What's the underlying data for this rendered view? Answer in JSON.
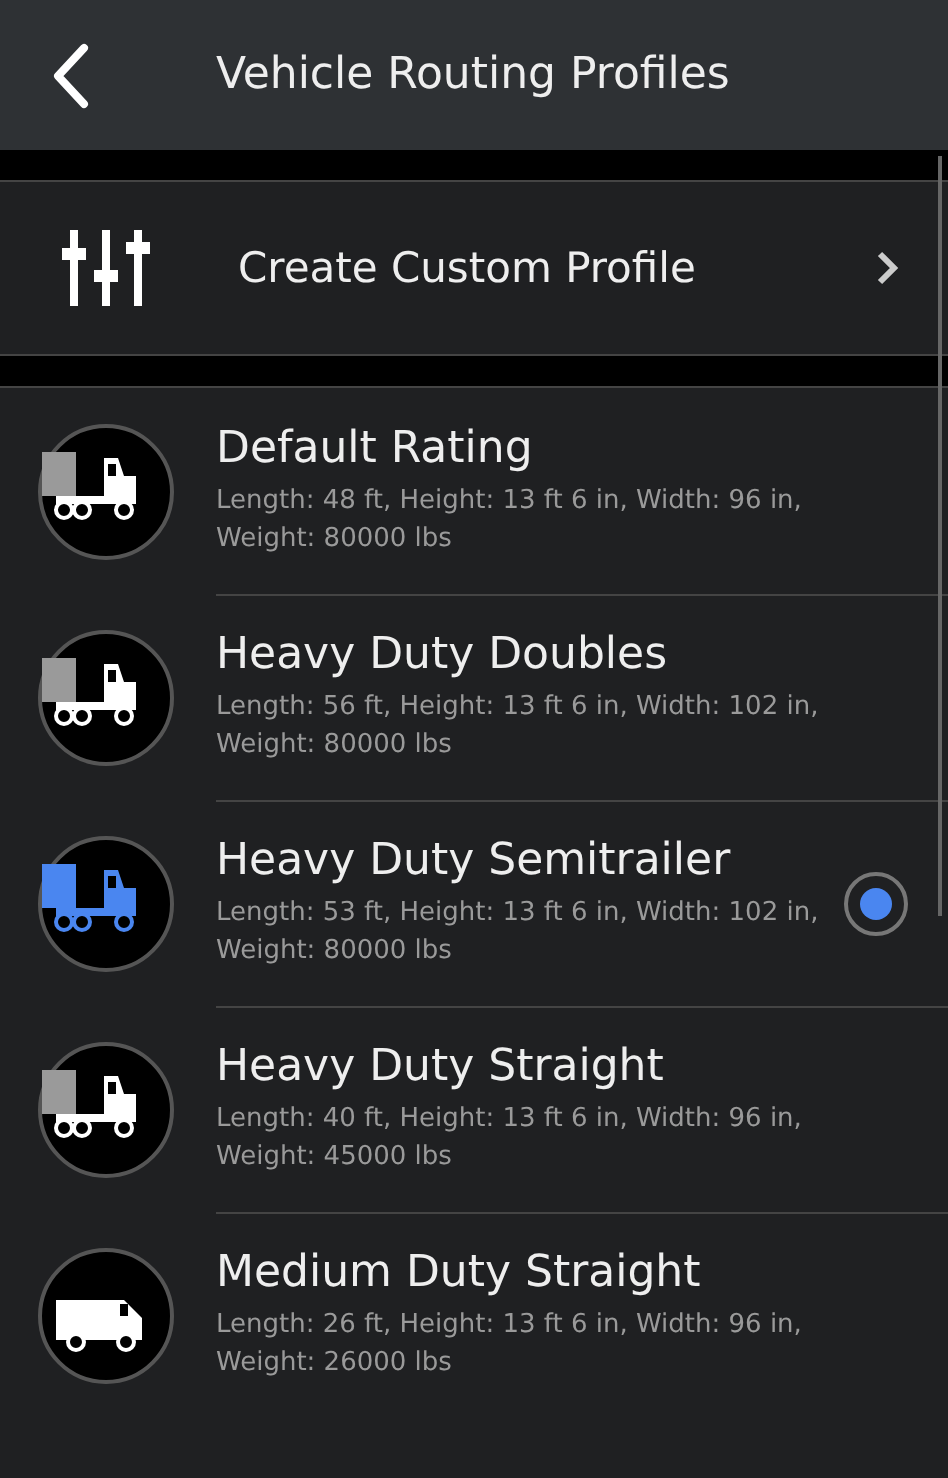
{
  "header": {
    "title": "Vehicle Routing Profiles"
  },
  "custom_profile": {
    "label": "Create Custom Profile"
  },
  "profiles": [
    {
      "kind": "tractor",
      "name": "Default Rating",
      "details": "Length: 48 ft, Height: 13 ft 6 in, Width: 96 in, Weight: 80000 lbs",
      "selected": false
    },
    {
      "kind": "tractor",
      "name": "Heavy Duty Doubles",
      "details": "Length: 56 ft, Height: 13 ft 6 in, Width: 102 in, Weight: 80000 lbs",
      "selected": false
    },
    {
      "kind": "tractor",
      "name": "Heavy Duty Semitrailer",
      "details": "Length: 53 ft, Height: 13 ft 6 in, Width: 102 in, Weight: 80000 lbs",
      "selected": true
    },
    {
      "kind": "tractor",
      "name": "Heavy Duty Straight",
      "details": "Length: 40 ft, Height: 13 ft 6 in, Width: 96 in, Weight: 45000 lbs",
      "selected": false
    },
    {
      "kind": "van",
      "name": "Medium Duty Straight",
      "details": "Length: 26 ft, Height: 13 ft 6 in, Width: 96 in, Weight: 26000 lbs",
      "selected": false
    }
  ]
}
